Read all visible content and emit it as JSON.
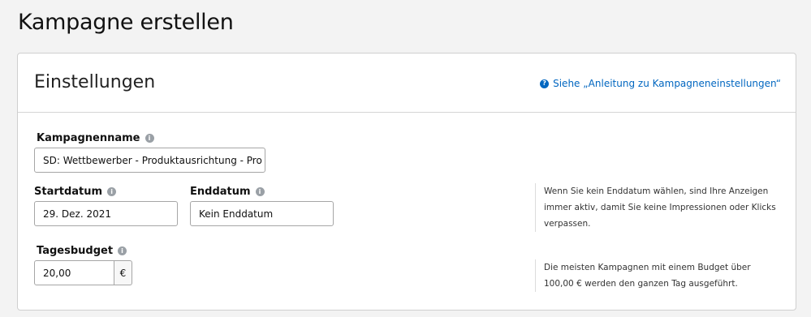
{
  "page": {
    "title": "Kampagne erstellen"
  },
  "section": {
    "title": "Einstellungen",
    "help_link": "Siehe „Anleitung zu Kampagneneinstellungen“"
  },
  "fields": {
    "campaign_name": {
      "label": "Kampagnenname",
      "value": "SD: Wettbewerber - Produktausrichtung - Pro"
    },
    "start_date": {
      "label": "Startdatum",
      "value": "29. Dez. 2021"
    },
    "end_date": {
      "label": "Enddatum",
      "value": "Kein Enddatum"
    },
    "daily_budget": {
      "label": "Tagesbudget",
      "value": "20,00",
      "currency": "€"
    }
  },
  "hints": {
    "end_date": "Wenn Sie kein Enddatum wählen, sind Ihre Anzeigen immer aktiv, damit Sie keine Impressionen oder Klicks verpassen.",
    "budget": "Die meisten Kampagnen mit einem Budget über 100,00 € werden den ganzen Tag ausgeführt."
  },
  "icons": {
    "info": "info-icon",
    "help": "help-icon"
  },
  "colors": {
    "link": "#0066c0",
    "info_icon": "#9aa0a6"
  }
}
